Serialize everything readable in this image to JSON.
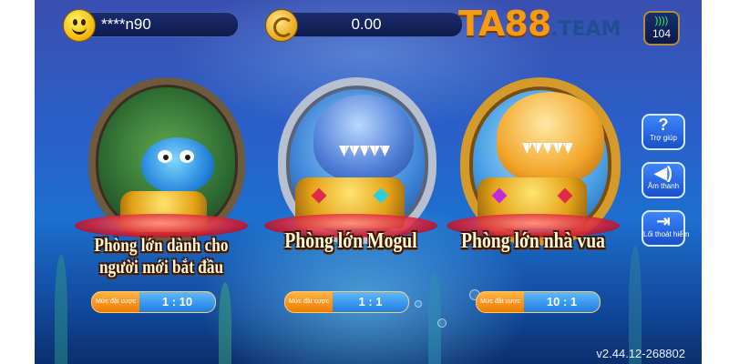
{
  "header": {
    "username": "****n90",
    "balance": "0.00",
    "logo": {
      "brand": "TA88",
      "suffix": ".TEAM"
    },
    "ping": "104",
    "icons": {
      "user": "smiley-face-icon",
      "coin": "gold-coin-icon",
      "signal": "wifi-signal-icon"
    }
  },
  "side_menu": {
    "help_label": "Trợ giúp",
    "sound_label": "Âm thanh",
    "exit_label": "Lối thoát hiểm",
    "help_icon": "?",
    "sound_icon": "◀)",
    "exit_icon": "⇥"
  },
  "rooms": [
    {
      "name_line1": "Phòng lớn dành cho",
      "name_line2": "người mới bắt đầu",
      "bet_label": "Mức đặt cược",
      "bet_value": "1 : 10",
      "mascot": "pufferfish"
    },
    {
      "name_line1": "Phòng lớn Mogul",
      "name_line2": "",
      "bet_label": "Mức đặt cược",
      "bet_value": "1 : 1",
      "mascot": "blue-shark"
    },
    {
      "name_line1": "Phòng lớn nhà vua",
      "name_line2": "",
      "bet_label": "Mức đặt cược",
      "bet_value": "10 : 1",
      "mascot": "golden-shark"
    }
  ],
  "footer": {
    "version": "v2.44.12-268802"
  },
  "colors": {
    "accent_gold": "#f79a0f",
    "bet_orange": "#ef7c00",
    "bet_blue": "#1f7ee0",
    "ocean": "#1d6fcf"
  }
}
